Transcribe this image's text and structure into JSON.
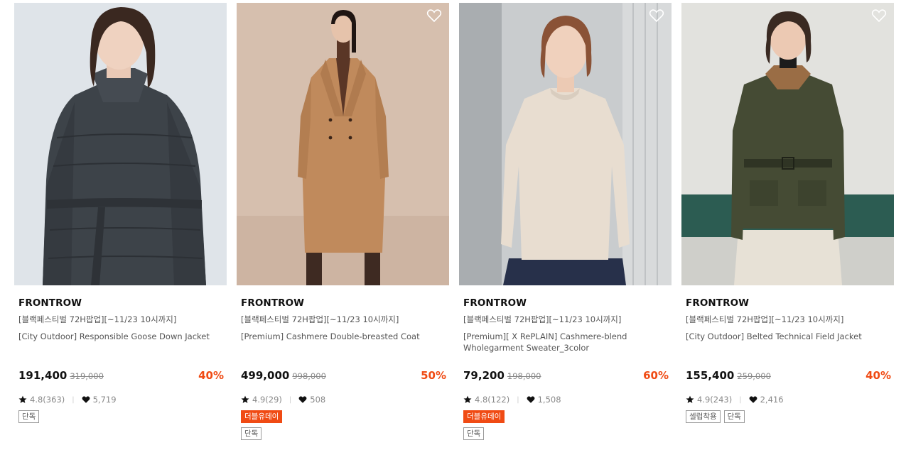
{
  "colors": {
    "accent": "#f04b14",
    "text": "#111111",
    "muted": "#888888"
  },
  "products": [
    {
      "brand": "FRONTROW",
      "promo": "[블랙페스티벌 72H팝업][~11/23 10시까지]",
      "name": "[City Outdoor] Responsible Goose Down Jacket",
      "price": "191,400",
      "original_price": "319,000",
      "discount": "40%",
      "rating": "4.8(363)",
      "likes": "5,719",
      "badges": [],
      "tags": [
        "단독"
      ],
      "has_heart": false
    },
    {
      "brand": "FRONTROW",
      "promo": "[블랙페스티벌 72H팝업][~11/23 10시까지]",
      "name": "[Premium] Cashmere Double-breasted Coat",
      "price": "499,000",
      "original_price": "998,000",
      "discount": "50%",
      "rating": "4.9(29)",
      "likes": "508",
      "badges": [
        "더블유데이"
      ],
      "tags": [
        "단독"
      ],
      "has_heart": true
    },
    {
      "brand": "FRONTROW",
      "promo": "[블랙페스티벌 72H팝업][~11/23 10시까지]",
      "name": "[Premium][ X RePLAIN] Cashmere-blend Wholegarment Sweater_3color",
      "price": "79,200",
      "original_price": "198,000",
      "discount": "60%",
      "rating": "4.8(122)",
      "likes": "1,508",
      "badges": [
        "더블유데이"
      ],
      "tags": [
        "단독"
      ],
      "has_heart": true
    },
    {
      "brand": "FRONTROW",
      "promo": "[블랙페스티벌 72H팝업][~11/23 10시까지]",
      "name": "[City Outdoor] Belted Technical Field Jacket",
      "price": "155,400",
      "original_price": "259,000",
      "discount": "40%",
      "rating": "4.9(243)",
      "likes": "2,416",
      "badges": [],
      "tags": [
        "셀럽착용",
        "단독"
      ],
      "has_heart": true
    }
  ]
}
